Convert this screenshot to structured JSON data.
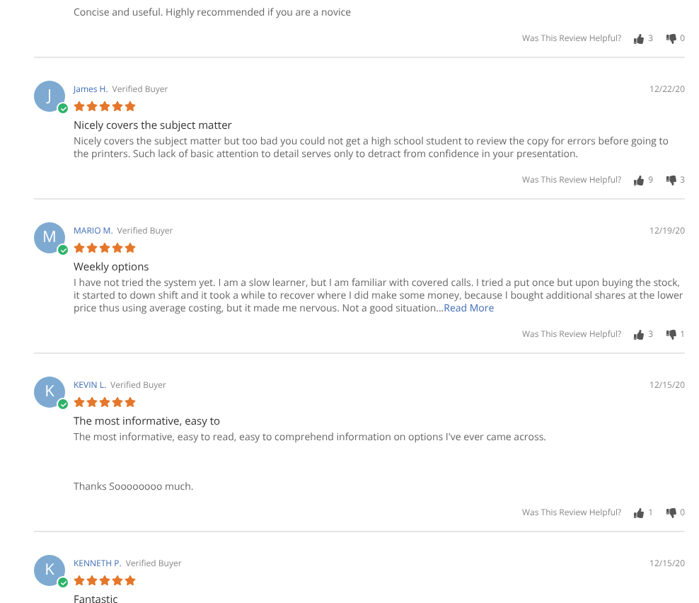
{
  "reviews": [
    {
      "body": [
        "Concise and useful. Highly recommended if you are a novice"
      ],
      "helpful": {
        "label": "Was This Review Helpful?",
        "up": "3",
        "down": "0"
      }
    },
    {
      "initial": "J",
      "name": "James H.",
      "badge": "Verified Buyer",
      "date": "12/22/20",
      "stars": 5,
      "title": "Nicely covers the subject matter",
      "body": [
        "Nicely covers the subject matter but too bad you could not get a high school student to review the copy for errors before going to the printers. Such lack of basic attention to detail serves only to detract from confidence in your presentation."
      ],
      "helpful": {
        "label": "Was This Review Helpful?",
        "up": "9",
        "down": "3"
      }
    },
    {
      "initial": "M",
      "name": "MARIO M.",
      "badge": "Verified Buyer",
      "date": "12/19/20",
      "stars": 5,
      "title": "Weekly options",
      "body": [
        "I have not tried the system yet. I am a slow learner, but I am familiar with covered calls. I tried a put once but upon buying the stock, it started to down shift and it took a while to recover where I did make some money, because I bought additional shares at the lower price thus using average costing, but it made me nervous. Not a good situation..."
      ],
      "read_more": "Read More",
      "helpful": {
        "label": "Was This Review Helpful?",
        "up": "3",
        "down": "1"
      }
    },
    {
      "initial": "K",
      "name": "KEVIN L.",
      "badge": "Verified Buyer",
      "date": "12/15/20",
      "stars": 5,
      "title": "The most informative, easy to",
      "body": [
        "The most informative, easy to read, easy to comprehend information on options I've ever came across.",
        "Thanks Soooooooo much."
      ],
      "helpful": {
        "label": "Was This Review Helpful?",
        "up": "1",
        "down": "0"
      }
    },
    {
      "initial": "K",
      "name": "KENNETH P.",
      "badge": "Verified Buyer",
      "date": "12/15/20",
      "stars": 5,
      "title": "Fantastic"
    }
  ]
}
